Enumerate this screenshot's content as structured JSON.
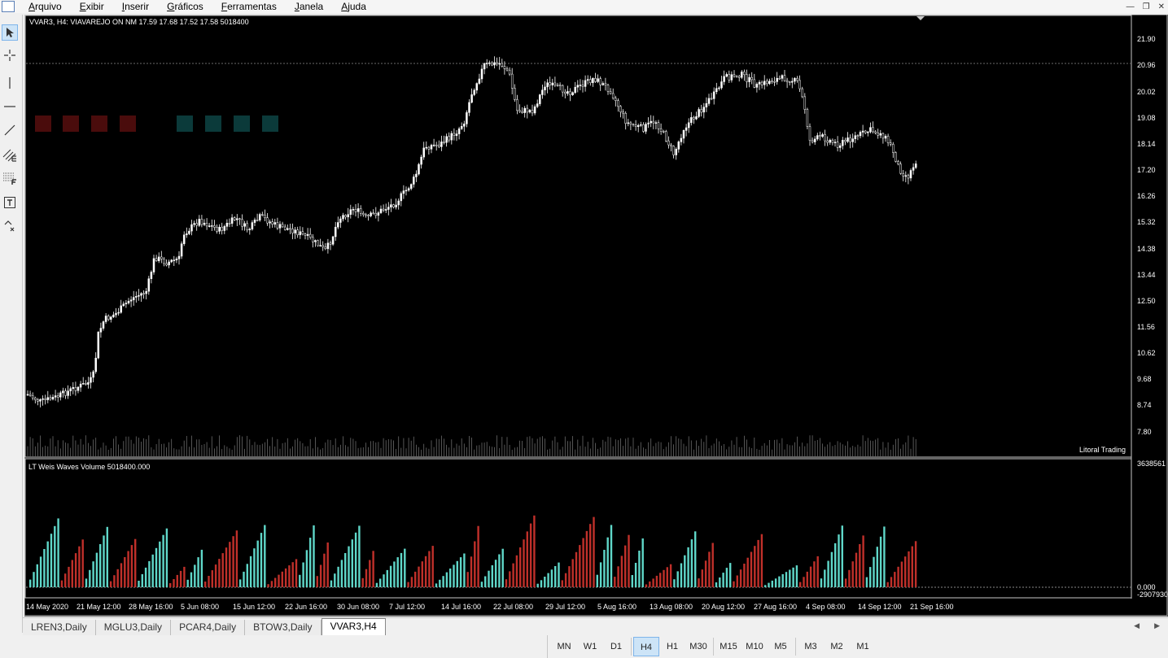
{
  "menu": {
    "items": [
      "Arquivo",
      "Exibir",
      "Inserir",
      "Gráficos",
      "Ferramentas",
      "Janela",
      "Ajuda"
    ]
  },
  "chart": {
    "header": "VVAR3, H4:  VIAVAREJO   ON     NM  17.59  17.68  17.52  17.58  5018400",
    "watermark": "Litoral Trading",
    "price_labels": [
      "21.90",
      "20.96",
      "20.02",
      "19.08",
      "18.14",
      "17.20",
      "16.26",
      "15.32",
      "14.38",
      "13.44",
      "12.50",
      "11.56",
      "10.62",
      "9.68",
      "8.74",
      "7.80"
    ],
    "indicator_label": "LT Weis Waves Volume 5018400.000",
    "indicator_top_value": "3638561",
    "indicator_zero": "0.000",
    "indicator_bottom_value": "-2907930",
    "time_labels": [
      "14 May 2020",
      "21 May 12:00",
      "28 May 16:00",
      "5 Jun 08:00",
      "15 Jun 12:00",
      "22 Jun 16:00",
      "30 Jun 08:00",
      "7 Jul 12:00",
      "14 Jul 16:00",
      "22 Jul 08:00",
      "29 Jul 12:00",
      "5 Aug 16:00",
      "13 Aug 08:00",
      "20 Aug 12:00",
      "27 Aug 16:00",
      "4 Sep 08:00",
      "14 Sep 12:00",
      "21 Sep 16:00"
    ]
  },
  "colors": {
    "chart_bg": "#000000",
    "candle": "#ffffff",
    "wave_up": "#5fd7c9",
    "wave_down": "#c0302a",
    "box_red": "#4a0c0c",
    "box_teal": "#0b3a3a"
  },
  "tabs": {
    "items": [
      "LREN3,Daily",
      "MGLU3,Daily",
      "PCAR4,Daily",
      "BTOW3,Daily",
      "VVAR3,H4"
    ],
    "active": "VVAR3,H4"
  },
  "timeframes": {
    "groups": [
      [
        "MN",
        "W1",
        "D1"
      ],
      [
        "H4",
        "H1",
        "M30"
      ],
      [
        "M15",
        "M10",
        "M5"
      ],
      [
        "M3",
        "M2",
        "M1"
      ]
    ],
    "active": "H4"
  }
}
